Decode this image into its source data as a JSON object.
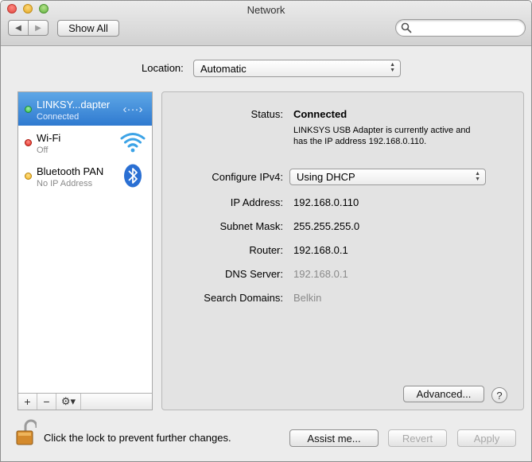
{
  "window": {
    "title": "Network"
  },
  "toolbar": {
    "back_icon": "◀",
    "forward_icon": "▶",
    "show_all_label": "Show All",
    "search_placeholder": ""
  },
  "location": {
    "label": "Location:",
    "value": "Automatic"
  },
  "services": [
    {
      "name": "LINKSY...dapter",
      "status": "Connected",
      "dot_color": "#2db84d",
      "icon": "ethernet-icon"
    },
    {
      "name": "Wi-Fi",
      "status": "Off",
      "dot_color": "#e0271e",
      "icon": "wifi-icon"
    },
    {
      "name": "Bluetooth PAN",
      "status": "No IP Address",
      "dot_color": "#f0b21e",
      "icon": "bluetooth-icon"
    }
  ],
  "sidebar_actions": {
    "add": "+",
    "remove": "−",
    "gear": "⚙▾"
  },
  "details": {
    "status_label": "Status:",
    "status_value": "Connected",
    "status_description_line1": "LINKSYS USB Adapter is currently active and",
    "status_description_line2": "has the IP address 192.168.0.110.",
    "configure_label": "Configure IPv4:",
    "configure_value": "Using DHCP",
    "ip_label": "IP Address:",
    "ip_value": "192.168.0.110",
    "subnet_label": "Subnet Mask:",
    "subnet_value": "255.255.255.0",
    "router_label": "Router:",
    "router_value": "192.168.0.1",
    "dns_label": "DNS Server:",
    "dns_value": "192.168.0.1",
    "search_domains_label": "Search Domains:",
    "search_domains_value": "Belkin",
    "advanced_label": "Advanced...",
    "help_label": "?"
  },
  "footer": {
    "lock_text": "Click the lock to prevent further changes.",
    "assist_label": "Assist me...",
    "revert_label": "Revert",
    "apply_label": "Apply"
  },
  "colors": {
    "selection": "#3b86d8",
    "connected": "#2db84d",
    "off": "#e0271e",
    "no_ip": "#f0b21e"
  }
}
